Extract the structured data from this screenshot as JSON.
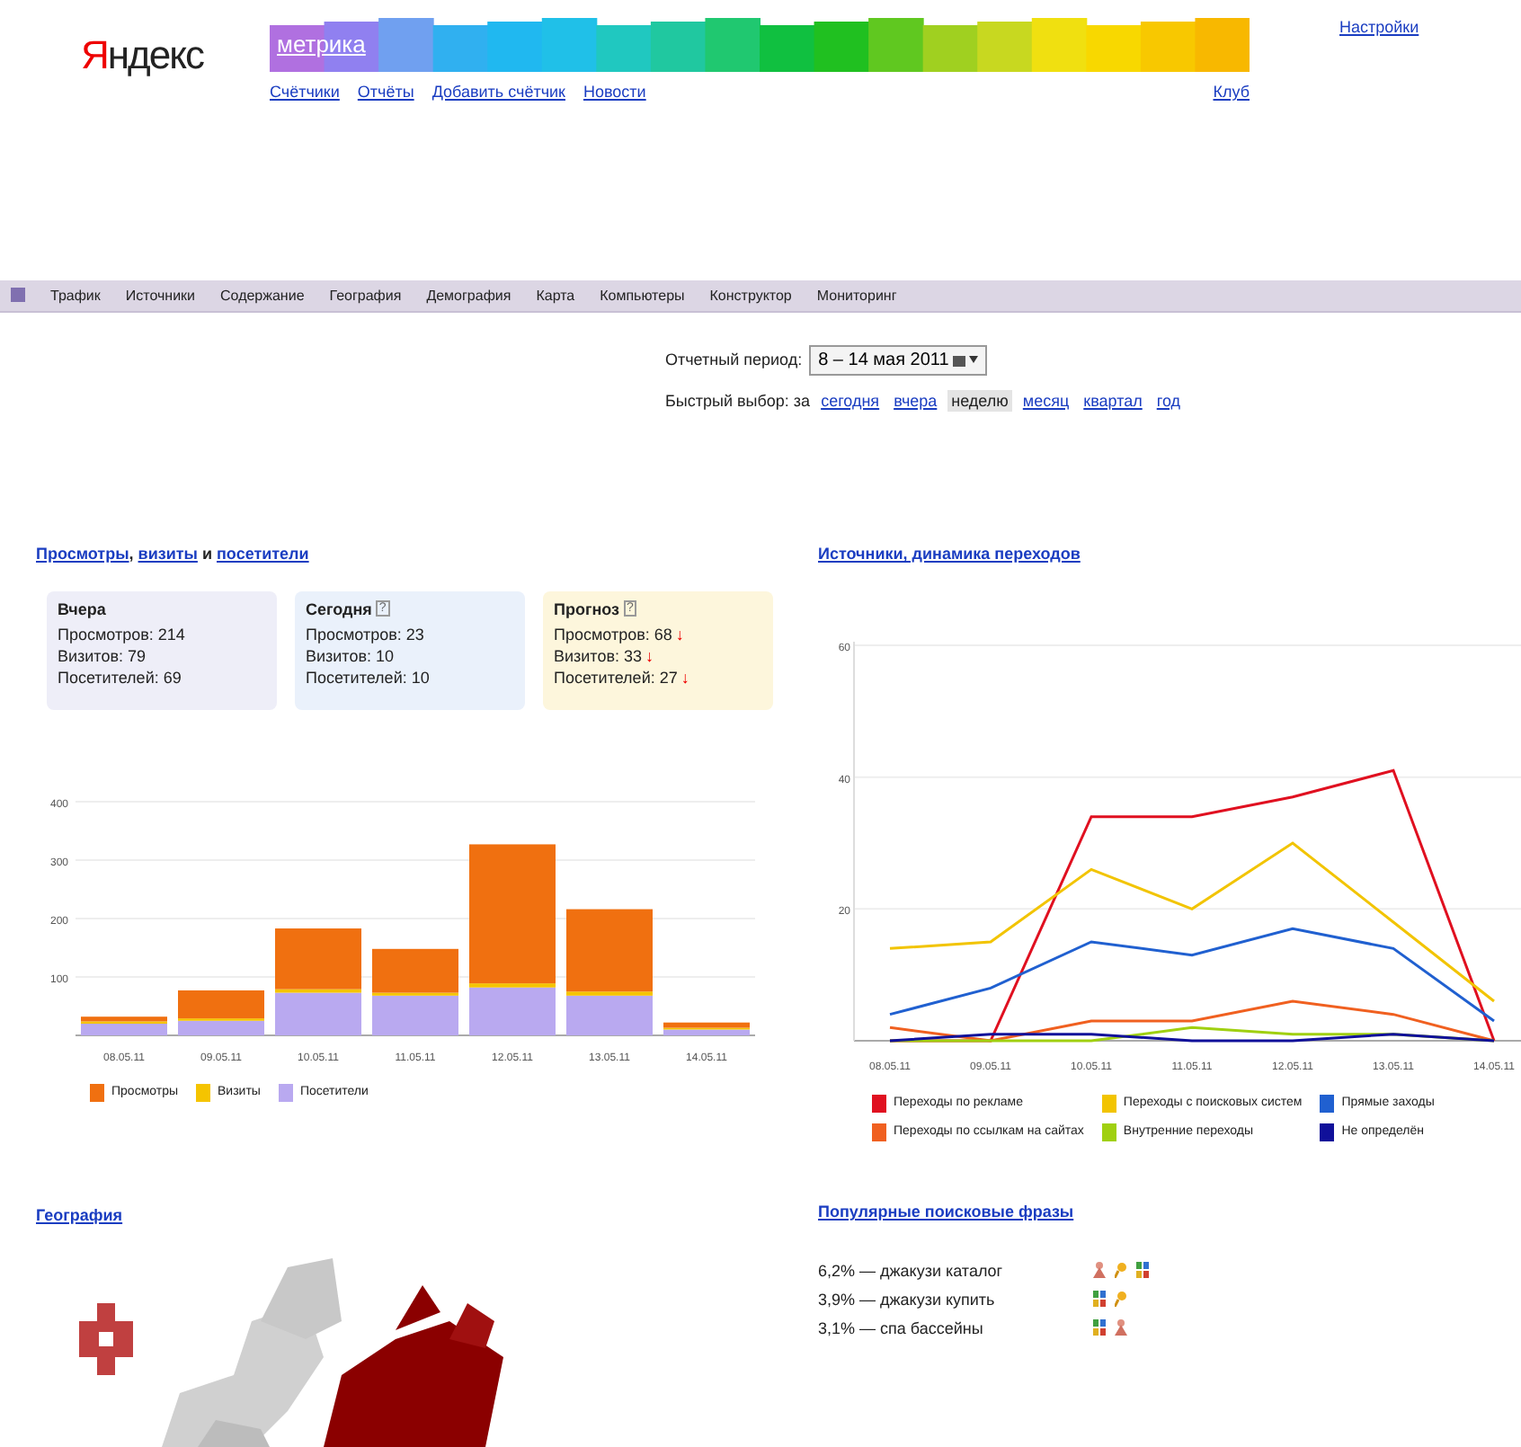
{
  "header": {
    "logo": "Яндекс",
    "product": "метрика",
    "links": [
      "Счётчики",
      "Отчёты",
      "Добавить счётчик",
      "Новости"
    ],
    "club": "Клуб",
    "settings": "Настройки"
  },
  "nav": {
    "items": [
      "Трафик",
      "Источники",
      "Содержание",
      "География",
      "Демография",
      "Карта",
      "Компьютеры",
      "Конструктор",
      "Мониторинг"
    ]
  },
  "period": {
    "label": "Отчетный период:",
    "value": "8 – 14 мая 2011",
    "quick_label": "Быстрый выбор: за",
    "quick": [
      {
        "label": "сегодня",
        "selected": false
      },
      {
        "label": "вчера",
        "selected": false
      },
      {
        "label": "неделю",
        "selected": true
      },
      {
        "label": "месяц",
        "selected": false
      },
      {
        "label": "квартал",
        "selected": false
      },
      {
        "label": "год",
        "selected": false
      }
    ]
  },
  "summary": {
    "title": [
      {
        "text": "Просмотры",
        "link": true
      },
      {
        "text": ", ",
        "link": false
      },
      {
        "text": "визиты",
        "link": true
      },
      {
        "text": " и ",
        "link": false
      },
      {
        "text": "посетители",
        "link": true
      }
    ],
    "cards": [
      {
        "title": "Вчера",
        "color": "#eeeef8",
        "lines": [
          {
            "text": "Просмотров: 214"
          },
          {
            "text": "Визитов: 79"
          },
          {
            "text": "Посетителей: 69"
          }
        ]
      },
      {
        "title": "Сегодня",
        "help": "?",
        "color": "#eaf1fb",
        "lines": [
          {
            "text": "Просмотров: 23"
          },
          {
            "text": "Визитов: 10"
          },
          {
            "text": "Посетителей: 10"
          }
        ]
      },
      {
        "title": "Прогноз",
        "help": "?",
        "color": "#fdf6dc",
        "lines": [
          {
            "text": "Просмотров: 68",
            "arrow": "↓"
          },
          {
            "text": "Визитов: 33",
            "arrow": "↓"
          },
          {
            "text": "Посетителей: 27",
            "arrow": "↓"
          }
        ]
      }
    ],
    "chart_data": {
      "type": "bar",
      "stacked": true,
      "grid": true,
      "categories": [
        "08.05.11",
        "09.05.11",
        "10.05.11",
        "11.05.11",
        "12.05.11",
        "13.05.11",
        "14.05.11"
      ],
      "ylim": [
        0,
        400
      ],
      "yticks": [
        100,
        200,
        300,
        400
      ],
      "series": [
        {
          "name": "Посетители",
          "color": "#b9a9f0",
          "values": [
            20,
            25,
            73,
            68,
            82,
            68,
            10
          ]
        },
        {
          "name": "Визиты",
          "color": "#f5c400",
          "values": [
            4,
            4,
            6,
            5,
            7,
            7,
            3
          ]
        },
        {
          "name": "Просмотры",
          "color": "#f07010",
          "values": [
            8,
            48,
            104,
            75,
            238,
            141,
            9
          ]
        }
      ]
    }
  },
  "sources": {
    "title": "Источники, динамика переходов",
    "chart_data": {
      "type": "line",
      "grid": true,
      "categories": [
        "08.05.11",
        "09.05.11",
        "10.05.11",
        "11.05.11",
        "12.05.11",
        "13.05.11",
        "14.05.11"
      ],
      "ylim": [
        0,
        60
      ],
      "yticks": [
        20,
        40,
        60
      ],
      "series": [
        {
          "name": "Переходы по рекламе",
          "color": "#e01020",
          "values": [
            0,
            0,
            34,
            34,
            37,
            41,
            0
          ]
        },
        {
          "name": "Переходы с поисковых систем",
          "color": "#f2c400",
          "values": [
            14,
            15,
            26,
            20,
            30,
            18,
            6
          ]
        },
        {
          "name": "Прямые заходы",
          "color": "#2060d0",
          "values": [
            4,
            8,
            15,
            13,
            17,
            14,
            3
          ]
        },
        {
          "name": "Переходы по ссылкам на сайтах",
          "color": "#f06020",
          "values": [
            2,
            0,
            3,
            3,
            6,
            4,
            0
          ]
        },
        {
          "name": "Внутренние переходы",
          "color": "#a0d010",
          "values": [
            0,
            0,
            0,
            2,
            1,
            1,
            0
          ]
        },
        {
          "name": "Не определён",
          "color": "#10109a",
          "values": [
            0,
            1,
            1,
            0,
            0,
            1,
            0
          ]
        }
      ]
    }
  },
  "geography": {
    "title": "География"
  },
  "phrases": {
    "title": "Популярные поисковые фразы",
    "items": [
      {
        "text": "6,2% — джакузи каталог",
        "engines": [
          {
            "kind": "figure"
          },
          {
            "kind": "magnifier"
          },
          {
            "kind": "tiles"
          }
        ]
      },
      {
        "text": "3,9% — джакузи купить",
        "engines": [
          {
            "kind": "tiles"
          },
          {
            "kind": "magnifier"
          }
        ]
      },
      {
        "text": "3,1% — спа бассейны",
        "engines": [
          {
            "kind": "tiles"
          },
          {
            "kind": "figure"
          }
        ]
      }
    ]
  }
}
